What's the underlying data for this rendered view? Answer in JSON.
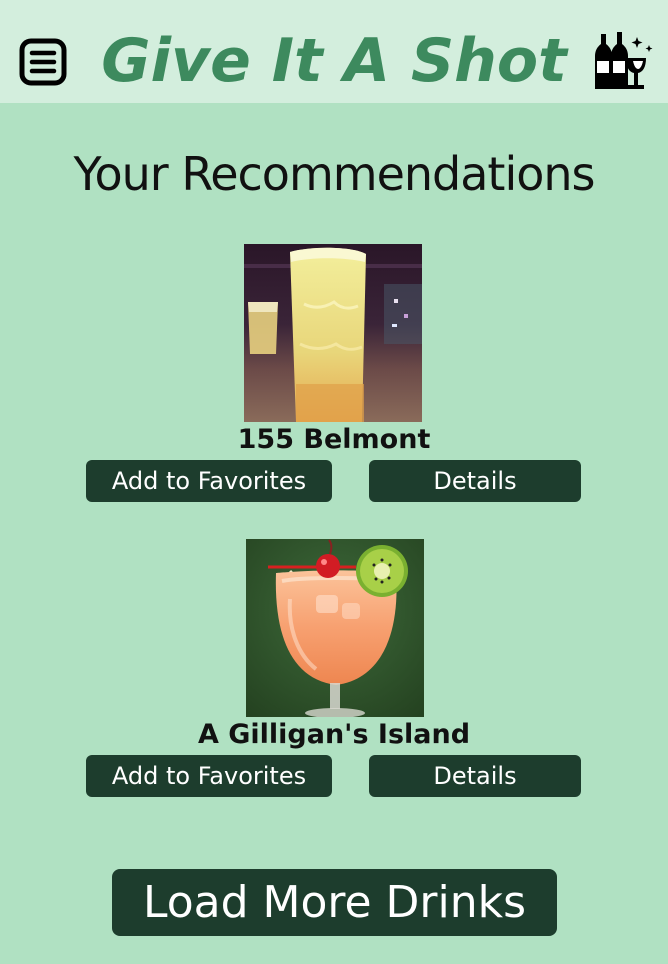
{
  "header": {
    "title": "Give It A Shot",
    "menu_icon": "menu-icon",
    "logo_icon": "wine-bottles-glass-icon"
  },
  "main": {
    "heading": "Your Recommendations",
    "drinks": [
      {
        "name": "155 Belmont",
        "favorite_label": "Add to Favorites",
        "details_label": "Details"
      },
      {
        "name": "A Gilligan's Island",
        "favorite_label": "Add to Favorites",
        "details_label": "Details"
      }
    ],
    "load_more_label": "Load More Drinks"
  },
  "colors": {
    "page_bg": "#b0e1c2",
    "header_bg": "#d3eedd",
    "title": "#3d8a5e",
    "button_bg": "#1d3d2d",
    "button_text": "#ffffff"
  }
}
